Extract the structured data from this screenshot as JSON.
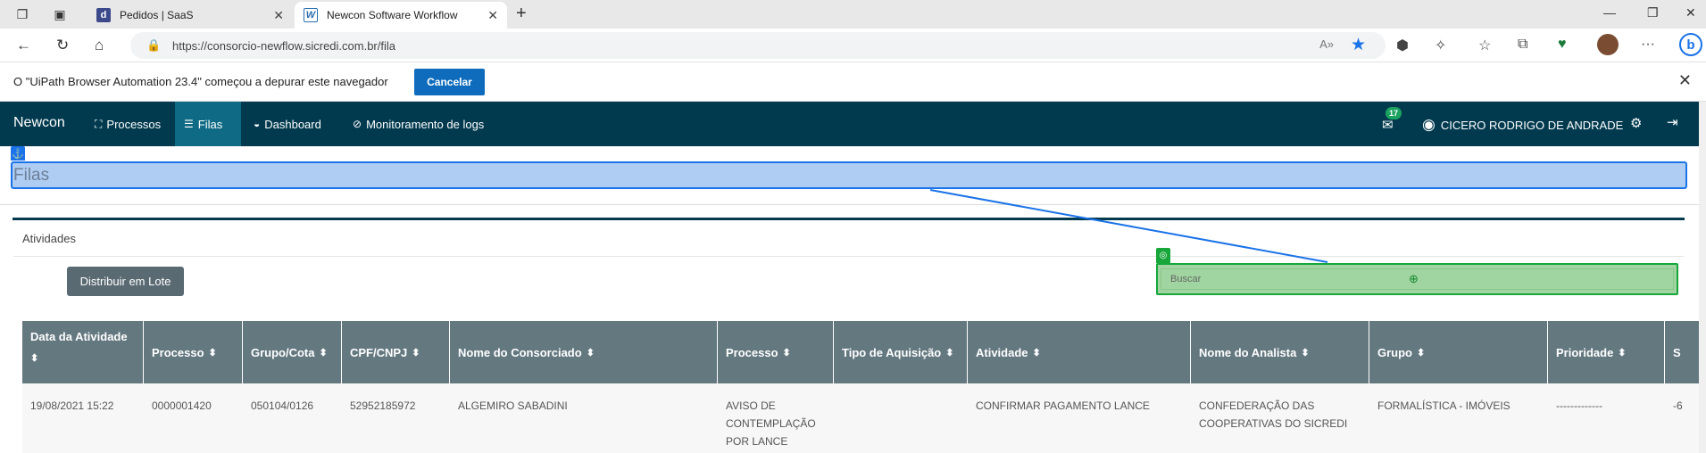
{
  "browser": {
    "tabs": [
      {
        "title": "Pedidos | SaaS",
        "favicon": "d"
      },
      {
        "title": "Newcon Software Workflow",
        "favicon": "W"
      }
    ],
    "url": "https://consorcio-newflow.sicredi.com.br/fila",
    "icons": [
      "tab-actions-icon",
      "workspaces-icon",
      "back-icon",
      "refresh-icon",
      "home-icon",
      "lock-icon",
      "read-aloud-icon",
      "favorite-star-icon",
      "extension-icon",
      "puzzle-icon",
      "favorites-icon",
      "collections-icon",
      "health-icon",
      "menu-icon",
      "bing-icon"
    ]
  },
  "infobar": {
    "message": "O \"UiPath Browser Automation 23.4\" começou a depurar este navegador",
    "cancel_label": "Cancelar"
  },
  "navbar": {
    "brand": "Newcon",
    "items": [
      {
        "label": "Processos",
        "icon": "sitemap-icon"
      },
      {
        "label": "Filas",
        "icon": "list-icon"
      },
      {
        "label": "Dashboard",
        "icon": "dashboard-icon"
      },
      {
        "label": "Monitoramento de logs",
        "icon": "compass-icon"
      }
    ],
    "notifications_count": "17",
    "user_name": "CICERO RODRIGO DE ANDRADE"
  },
  "page": {
    "title": "Filas",
    "panel_title": "Atividades",
    "batch_button": "Distribuir em Lote",
    "search_placeholder": "Buscar"
  },
  "table": {
    "headers": [
      "Data da Atividade",
      "Processo",
      "Grupo/Cota",
      "CPF/CNPJ",
      "Nome do Consorciado",
      "Processo",
      "Tipo de Aquisição",
      "Atividade",
      "Nome do Analista",
      "Grupo",
      "Prioridade",
      "S"
    ],
    "rows": [
      {
        "data": "19/08/2021 15:22",
        "processo": "0000001420",
        "grupo_cota": "050104/0126",
        "cpf_cnpj": "52952185972",
        "nome": "ALGEMIRO SABADINI",
        "processo_desc_1": "AVISO DE",
        "processo_desc_2": "CONTEMPLAÇÃO",
        "processo_desc_3": "POR LANCE",
        "tipo_aquisicao": "",
        "atividade": "CONFIRMAR PAGAMENTO LANCE",
        "analista_1": "CONFEDERAÇÃO DAS",
        "analista_2": "COOPERATIVAS DO SICREDI",
        "grupo": "FORMALÍSTICA - IMÓVEIS",
        "prioridade": "-------------",
        "s": "-6"
      }
    ]
  }
}
